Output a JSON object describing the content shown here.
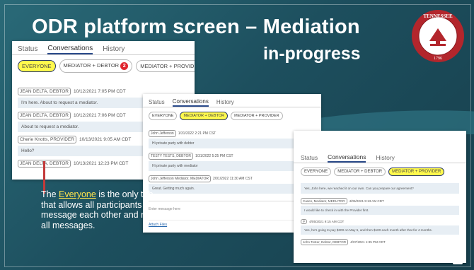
{
  "title": "ODR platform screen – Mediation",
  "subtitle": "in-progress",
  "seal": {
    "top_text": "TENNESSEE",
    "side_text": "THE JUDICIARY",
    "year": "1796"
  },
  "caption": {
    "pre": "The ",
    "highlight": "Everyone",
    "post": " is the only tab that allows all participants message each other and read all messages."
  },
  "panel1": {
    "tabs": [
      "Status",
      "Conversations",
      "History"
    ],
    "active_tab": 1,
    "pills": [
      "EVERYONE",
      "MEDIATOR + DEBTOR",
      "MEDIATOR + PROVIDER"
    ],
    "badge": "2",
    "messages": [
      {
        "author": "JEAN DELTA, DEBTOR",
        "time": "10/12/2021 7:05 PM CDT",
        "text": "I'm here. About to request a mediator."
      },
      {
        "author": "JEAN DELTA, DEBTOR",
        "time": "10/12/2021 7:06 PM CDT",
        "text": "About to request a mediator."
      },
      {
        "author": "Cherie Knotts, PROVIDER",
        "time": "10/13/2021 9:05 AM CDT",
        "text": "Hello?"
      },
      {
        "author": "JEAN DELTA, DEBTOR",
        "time": "10/13/2021 12:23 PM CDT",
        "text": ""
      }
    ]
  },
  "panel2": {
    "tabs": [
      "Status",
      "Conversations",
      "History"
    ],
    "pills": [
      "EVERYONE",
      "MEDIATOR + DEBTOR",
      "MEDIATOR + PROVIDER"
    ],
    "messages": [
      {
        "author": "John Jefferson",
        "time": "1/31/2022 2:21 PM CST",
        "text": "Hi private party with debtor"
      },
      {
        "author": "TESTY TESTS, DEBTOR",
        "time": "1/31/2022 5:25 PM CST",
        "text": "Hi private party with mediator"
      },
      {
        "author": "John Jefferson Mediator, MEDIATOR",
        "time": "2/01/2022 11:30 AM CST",
        "text": "Great. Getting much again."
      }
    ],
    "input_placeholder": "Enter message here",
    "attach": "Attach Files"
  },
  "panel3": {
    "tabs": [
      "Status",
      "Conversations",
      "History"
    ],
    "pills": [
      "EVERYONE",
      "MEDIATOR + DEBTOR",
      "MEDIATOR + PROVIDER"
    ],
    "messages": [
      {
        "author": "",
        "time": "",
        "text": "Yes, John here, we reached it on our own. Can you prepare our agreement?"
      },
      {
        "author": "Cases, Mediator, MEDIATOR",
        "time": "4/05/2021 9:13 AM CDT",
        "text": "I would like to check in with the Provider first."
      },
      {
        "author": "P",
        "time": "4/05/2021 9:15 AM CDT",
        "text": "Yes, he's going to pay $300 on May 5, and then $100 each month after that for 4 months."
      },
      {
        "author": "John Tester, Debtor, DEBTOR",
        "time": "4/07/2021 1:35 PM CDT",
        "text": ""
      }
    ]
  },
  "colors": {
    "bg": "#1d4f5e",
    "selected_pill": "#fff94d",
    "badge": "#e0262f",
    "highlight_text": "#ffe44d",
    "seal": "#b3262c"
  }
}
